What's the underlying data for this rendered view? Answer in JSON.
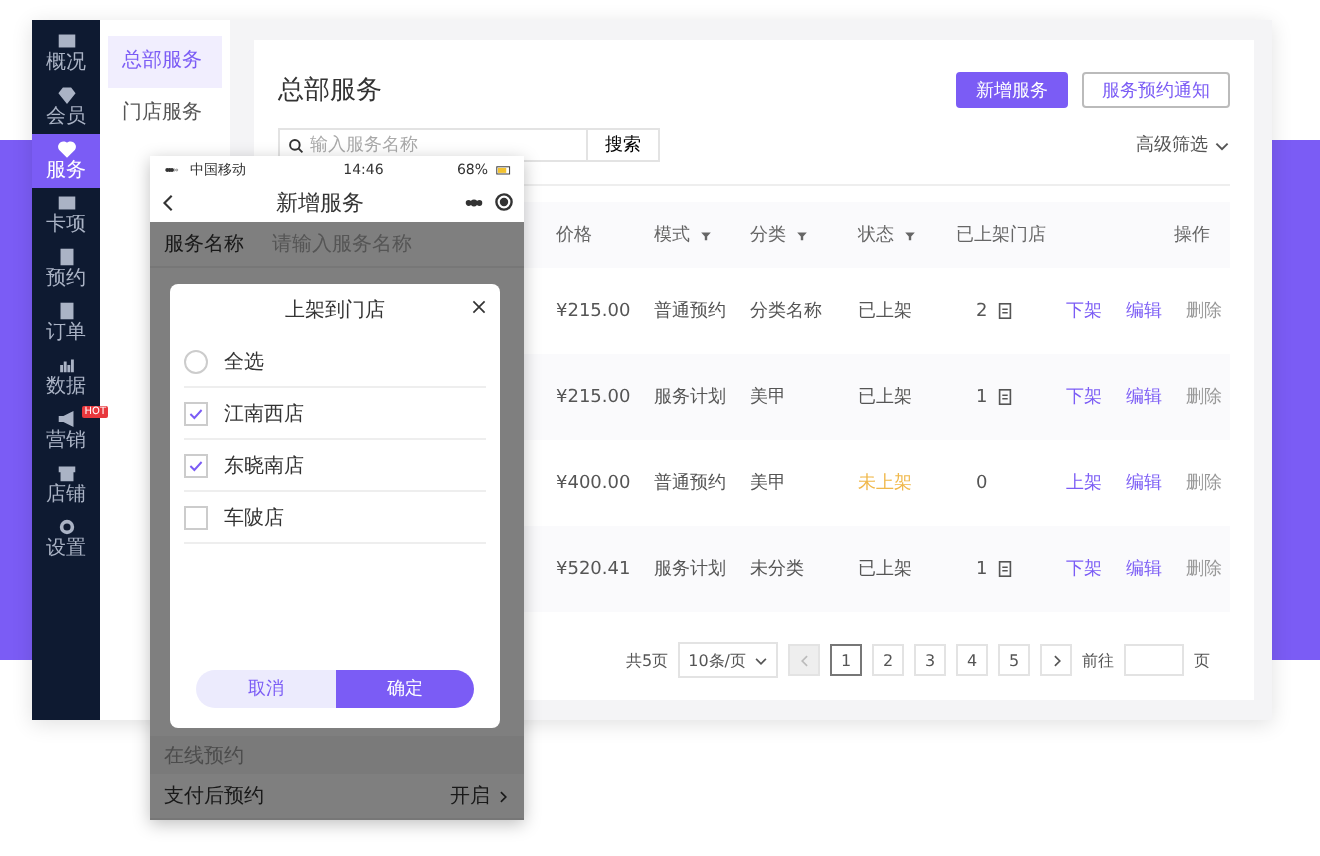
{
  "sidebar": {
    "items": [
      {
        "label": "概况",
        "selected": false
      },
      {
        "label": "会员",
        "selected": false
      },
      {
        "label": "服务",
        "selected": true
      },
      {
        "label": "卡项",
        "selected": false
      },
      {
        "label": "预约",
        "selected": false
      },
      {
        "label": "订单",
        "selected": false
      },
      {
        "label": "数据",
        "selected": false
      },
      {
        "label": "营销",
        "selected": false,
        "badge": "HOT"
      },
      {
        "label": "店铺",
        "selected": false
      },
      {
        "label": "设置",
        "selected": false
      }
    ]
  },
  "submenu": {
    "items": [
      {
        "label": "总部服务",
        "selected": true
      },
      {
        "label": "门店服务",
        "selected": false
      }
    ]
  },
  "page": {
    "title": "总部服务",
    "buttons": [
      {
        "label": "新增服务",
        "kind": "primary"
      },
      {
        "label": "服务预约通知",
        "kind": "outline"
      }
    ],
    "search": {
      "placeholder": "输入服务名称",
      "button": "搜索"
    },
    "filter": "高级筛选"
  },
  "table": {
    "columns": [
      {
        "label": "价格",
        "filter": false
      },
      {
        "label": "模式",
        "filter": true
      },
      {
        "label": "分类",
        "filter": true
      },
      {
        "label": "状态",
        "filter": true
      },
      {
        "label": "已上架门店",
        "filter": false
      },
      {
        "label": "操作",
        "filter": false
      }
    ],
    "rows": [
      {
        "price": "¥215.00",
        "mode": "普通预约",
        "category": "分类名称",
        "status": "已上架",
        "listed": true,
        "stores": "2",
        "store_icon": true,
        "actions": [
          "下架",
          "编辑",
          "删除"
        ]
      },
      {
        "price": "¥215.00",
        "mode": "服务计划",
        "category": "美甲",
        "status": "已上架",
        "listed": true,
        "stores": "1",
        "store_icon": true,
        "actions": [
          "下架",
          "编辑",
          "删除"
        ]
      },
      {
        "price": "¥400.00",
        "mode": "普通预约",
        "category": "美甲",
        "status": "未上架",
        "listed": false,
        "stores": "0",
        "store_icon": false,
        "actions": [
          "上架",
          "编辑",
          "删除"
        ]
      },
      {
        "price": "¥520.41",
        "mode": "服务计划",
        "category": "未分类",
        "status": "已上架",
        "listed": true,
        "stores": "1",
        "store_icon": true,
        "actions": [
          "下架",
          "编辑",
          "删除"
        ]
      }
    ]
  },
  "pagination": {
    "total": "共5页",
    "page_size": "10条/页",
    "prev_disabled": true,
    "pages": [
      {
        "label": "1",
        "selected": true
      },
      {
        "label": "2",
        "selected": false
      },
      {
        "label": "3",
        "selected": false
      },
      {
        "label": "4",
        "selected": false
      },
      {
        "label": "5",
        "selected": false
      }
    ],
    "goto": "前往",
    "goto_suffix": "页"
  },
  "phone": {
    "status_bar": {
      "carrier": "中国移动",
      "time": "14:46",
      "battery": "68%"
    },
    "title": "新增服务",
    "form_top": {
      "label": "服务名称",
      "placeholder": "请输入服务名称"
    },
    "section": "在线预约",
    "form_bottom": {
      "label": "支付后预约",
      "value": "开启"
    },
    "dialog": {
      "title": "上架到门店",
      "options": [
        {
          "label": "全选",
          "kind": "radio",
          "checked": false
        },
        {
          "label": "江南西店",
          "kind": "checkbox",
          "checked": true
        },
        {
          "label": "东晓南店",
          "kind": "checkbox",
          "checked": true
        },
        {
          "label": "车陂店",
          "kind": "checkbox",
          "checked": false
        }
      ],
      "buttons": [
        {
          "label": "取消",
          "kind": "secondary"
        },
        {
          "label": "确定",
          "kind": "primary"
        }
      ]
    }
  }
}
